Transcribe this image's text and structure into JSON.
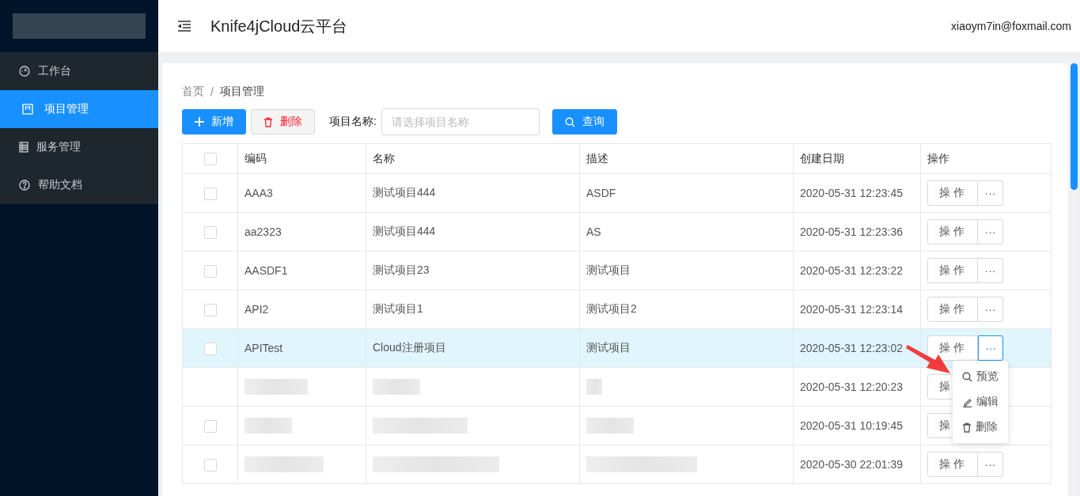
{
  "sidebar": {
    "items": [
      {
        "label": "工作台",
        "selected": false
      },
      {
        "label": "项目管理",
        "selected": true
      },
      {
        "label": "服务管理",
        "selected": false
      },
      {
        "label": "帮助文档",
        "selected": false
      }
    ]
  },
  "header": {
    "title": "Knife4jCloud云平台",
    "user": "xiaoym7in@foxmail.com"
  },
  "breadcrumb": {
    "items": [
      "首页",
      "项目管理"
    ],
    "separator": "/"
  },
  "toolbar": {
    "buttons": [
      {
        "kind": "primary",
        "label": "新增"
      },
      {
        "kind": "danger",
        "label": "删除"
      }
    ],
    "filter_label": "项目名称:",
    "filter_placeholder": "请选择项目名称",
    "search_button": "查询"
  },
  "table": {
    "header_checked": false,
    "columns": [
      "编码",
      "名称",
      "描述",
      "创建日期",
      "操作"
    ],
    "rows": [
      {
        "code": "AAA3",
        "name": "测试项目444",
        "description": "ASDF",
        "created": "2020-05-31 12:23:45",
        "action": "操 作",
        "more": "···",
        "checked": false,
        "hovered": false
      },
      {
        "code": "aa2323",
        "name": "测试项目444",
        "description": "AS",
        "created": "2020-05-31 12:23:36",
        "action": "操 作",
        "more": "···",
        "checked": false,
        "hovered": false
      },
      {
        "code": "AASDF1",
        "name": "测试项目23",
        "description": "测试项目",
        "created": "2020-05-31 12:23:22",
        "action": "操 作",
        "more": "···",
        "checked": false,
        "hovered": false
      },
      {
        "code": "API2",
        "name": "测试项目1",
        "description": "测试项目2",
        "created": "2020-05-31 12:23:14",
        "action": "操 作",
        "more": "···",
        "checked": false,
        "hovered": false
      },
      {
        "code": "APITest",
        "name": "Cloud注册项目",
        "description": "测试项目",
        "created": "2020-05-31 12:23:02",
        "action": "操 作",
        "more": "···",
        "checked": false,
        "hovered": true
      },
      {
        "kind": "redacted",
        "created": "2020-05-31 12:20:23",
        "action": "操",
        "hovered": false
      },
      {
        "kind": "redacted",
        "created": "2020-05-31 10:19:45",
        "action": "操",
        "checked": false,
        "hovered": false
      },
      {
        "kind": "redacted",
        "created": "2020-05-30 22:01:39",
        "action": "操 作",
        "more": "···",
        "checked": false,
        "hovered": false
      }
    ]
  },
  "dropdown": {
    "items": [
      {
        "label": "预览"
      },
      {
        "label": "编辑"
      },
      {
        "label": "删除"
      }
    ]
  }
}
